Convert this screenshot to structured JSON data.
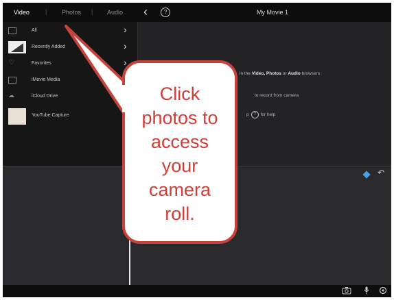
{
  "topbar": {
    "tabs": [
      {
        "label": "Video"
      },
      {
        "label": "Photos"
      },
      {
        "label": "Audio"
      }
    ],
    "title": "My Movie 1",
    "back_icon": "chevron-left-icon",
    "help_icon": "help-icon",
    "help_glyph": "?"
  },
  "library": {
    "items": [
      {
        "label": "All",
        "icon": "film-icon",
        "chevron": "›"
      },
      {
        "label": "Recently Added",
        "icon": "thumbnail",
        "chevron": "›"
      },
      {
        "label": "Favorites",
        "icon": "heart-icon",
        "chevron": "›"
      },
      {
        "label": "iMovie Media",
        "icon": "film-icon"
      },
      {
        "label": "iCloud Drive",
        "icon": "cloud-icon"
      },
      {
        "label": "YouTube Capture",
        "icon": "thumbnail"
      }
    ]
  },
  "viewer": {
    "hint_line1_prefix": "in the",
    "hint_line1_video": "Video,",
    "hint_line1_photos": "Photos",
    "hint_line1_or": "or",
    "hint_line1_audio": "Audio",
    "hint_line1_suffix": "browsers",
    "hint_line2": "to record from camera",
    "hint_line3_prefix": "p",
    "hint_line3_suffix": "for help",
    "help_glyph": "?"
  },
  "timeline": {
    "accent_color": "#4a9fe0"
  },
  "bottombar": {
    "icons": [
      "camera-icon",
      "microphone-icon",
      "settings-icon"
    ]
  },
  "callout": {
    "text_lines": [
      "Click",
      "photos to",
      "access",
      "your",
      "camera",
      "roll."
    ],
    "border_color": "#c7413d",
    "text_color": "#cf3f3a"
  }
}
